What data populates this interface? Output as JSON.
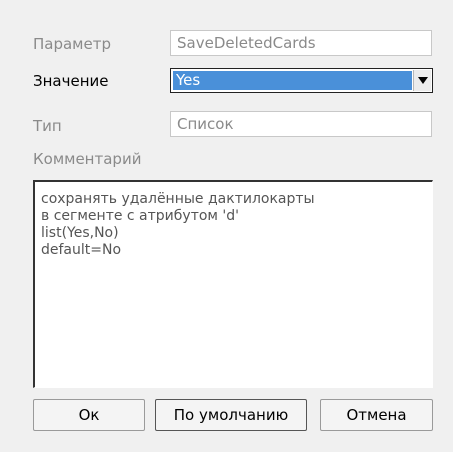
{
  "form": {
    "parameter": {
      "label": "Параметр",
      "value": "SaveDeletedCards"
    },
    "value": {
      "label": "Значение",
      "selected": "Yes"
    },
    "type": {
      "label": "Тип",
      "value": "Список"
    },
    "comment": {
      "label": "Комментарий",
      "lines": [
        "сохранять удалённые дактилокарты",
        "в сегменте с атрибутом 'd'",
        "list(Yes,No)",
        "default=No"
      ]
    }
  },
  "buttons": {
    "ok_label": "Ок",
    "default_label": "По умолчанию",
    "cancel_label": "Отмена"
  },
  "colors": {
    "selection": "#4a90d9",
    "dialog_bg": "#f0f0f0"
  },
  "icons": {
    "combo_arrow": "chevron-down-icon"
  }
}
